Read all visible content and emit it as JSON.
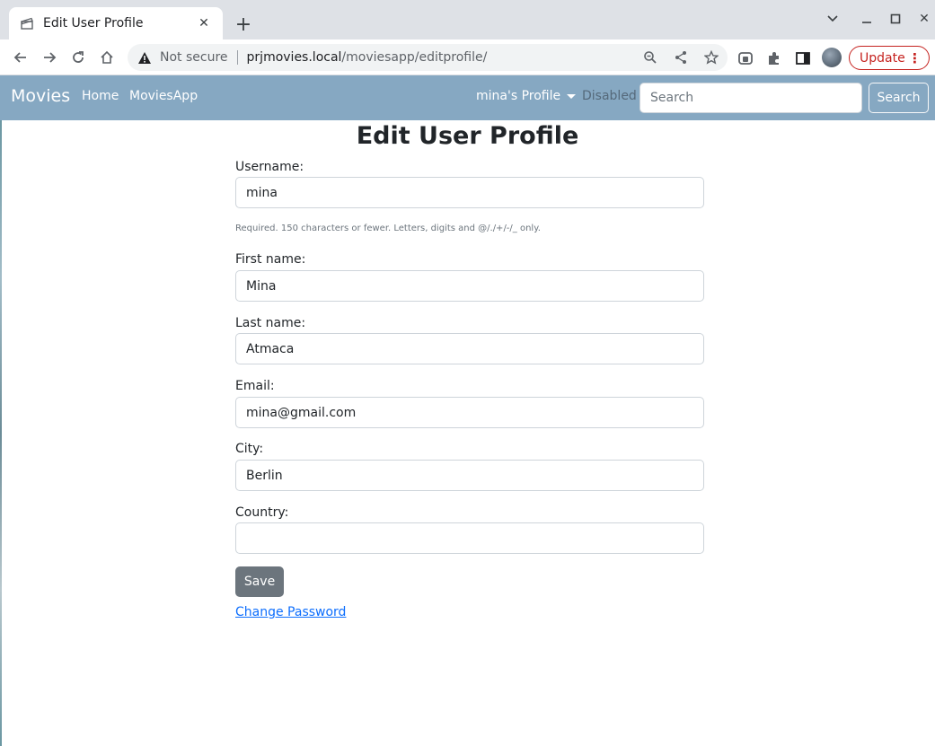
{
  "browser": {
    "tab_title": "Edit User Profile",
    "new_tab_symbol": "+",
    "security_label": "Not secure",
    "url_host": "prjmovies.local",
    "url_path": "/moviesapp/editprofile/",
    "update_label": "Update"
  },
  "navbar": {
    "brand": "Movies",
    "links": [
      "Home",
      "MoviesApp"
    ],
    "profile_label": "mina's Profile",
    "disabled_label": "Disabled",
    "search_placeholder": "Search",
    "search_button": "Search",
    "bg_color": "#86a8c2"
  },
  "form": {
    "title": "Edit User Profile",
    "username_label": "Username:",
    "username_value": "mina",
    "username_help": "Required. 150 characters or fewer. Letters, digits and @/./+/-/_ only.",
    "first_name_label": "First name:",
    "first_name_value": "Mina",
    "last_name_label": "Last name:",
    "last_name_value": "Atmaca",
    "email_label": "Email:",
    "email_value": "mina@gmail.com",
    "city_label": "City:",
    "city_value": "Berlin",
    "country_label": "Country:",
    "country_value": "",
    "save_button": "Save",
    "change_password_link": "Change Password"
  }
}
